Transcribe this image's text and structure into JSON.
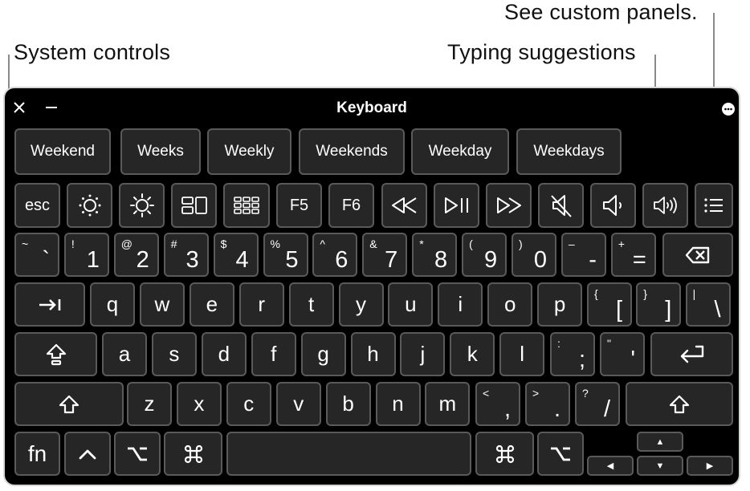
{
  "callouts": {
    "system_controls": "System controls",
    "typing_suggestions": "Typing suggestions",
    "custom_panels": "See custom panels."
  },
  "window": {
    "title": "Keyboard",
    "close_icon": "close-icon",
    "minimize_icon": "minimize-icon",
    "more_icon": "ellipsis-circle-icon"
  },
  "suggestions": [
    "Weekend",
    "Weeks",
    "Weekly",
    "Weekends",
    "Weekday",
    "Weekdays"
  ],
  "function_row": [
    {
      "label": "esc",
      "icon": null
    },
    {
      "label": "",
      "icon": "brightness-down-icon"
    },
    {
      "label": "",
      "icon": "brightness-up-icon"
    },
    {
      "label": "",
      "icon": "mission-control-icon"
    },
    {
      "label": "",
      "icon": "launchpad-icon"
    },
    {
      "label": "F5",
      "icon": null
    },
    {
      "label": "F6",
      "icon": null
    },
    {
      "label": "",
      "icon": "rewind-icon"
    },
    {
      "label": "",
      "icon": "play-pause-icon"
    },
    {
      "label": "",
      "icon": "fast-forward-icon"
    },
    {
      "label": "",
      "icon": "mute-icon"
    },
    {
      "label": "",
      "icon": "volume-down-icon"
    },
    {
      "label": "",
      "icon": "volume-up-icon"
    },
    {
      "label": "",
      "icon": "custom-panels-list-icon"
    }
  ],
  "number_row": [
    {
      "shift": "~",
      "main": "`"
    },
    {
      "shift": "!",
      "main": "1"
    },
    {
      "shift": "@",
      "main": "2"
    },
    {
      "shift": "#",
      "main": "3"
    },
    {
      "shift": "$",
      "main": "4"
    },
    {
      "shift": "%",
      "main": "5"
    },
    {
      "shift": "^",
      "main": "6"
    },
    {
      "shift": "&",
      "main": "7"
    },
    {
      "shift": "*",
      "main": "8"
    },
    {
      "shift": "(",
      "main": "9"
    },
    {
      "shift": ")",
      "main": "0"
    },
    {
      "shift": "–",
      "main": "-"
    },
    {
      "shift": "+",
      "main": "="
    }
  ],
  "number_row_delete_icon": "delete-backspace-icon",
  "tab_icon": "tab-icon",
  "qwerty_row": [
    "q",
    "w",
    "e",
    "r",
    "t",
    "y",
    "u",
    "i",
    "o",
    "p"
  ],
  "qwerty_row_dual": [
    {
      "shift": "{",
      "main": "["
    },
    {
      "shift": "}",
      "main": "]"
    },
    {
      "shift": "|",
      "main": "\\"
    }
  ],
  "caps_lock_icon": "caps-lock-icon",
  "home_row": [
    "a",
    "s",
    "d",
    "f",
    "g",
    "h",
    "j",
    "k",
    "l"
  ],
  "home_row_dual": [
    {
      "shift": ":",
      "main": ";"
    },
    {
      "shift": "\"",
      "main": "'"
    }
  ],
  "return_icon": "return-icon",
  "shift_icon": "shift-icon",
  "bottom_letters": [
    "z",
    "x",
    "c",
    "v",
    "b",
    "n",
    "m"
  ],
  "bottom_letters_dual": [
    {
      "shift": "<",
      "main": ","
    },
    {
      "shift": ">",
      "main": "."
    },
    {
      "shift": "?",
      "main": "/"
    }
  ],
  "modifier_row": {
    "fn": "fn",
    "control": "^",
    "option": "⌥",
    "command": "⌘",
    "space": "",
    "right_command": "⌘",
    "right_option": "⌥"
  },
  "arrows": {
    "up": "▲",
    "left": "◀",
    "down": "▼",
    "right": "▶"
  }
}
